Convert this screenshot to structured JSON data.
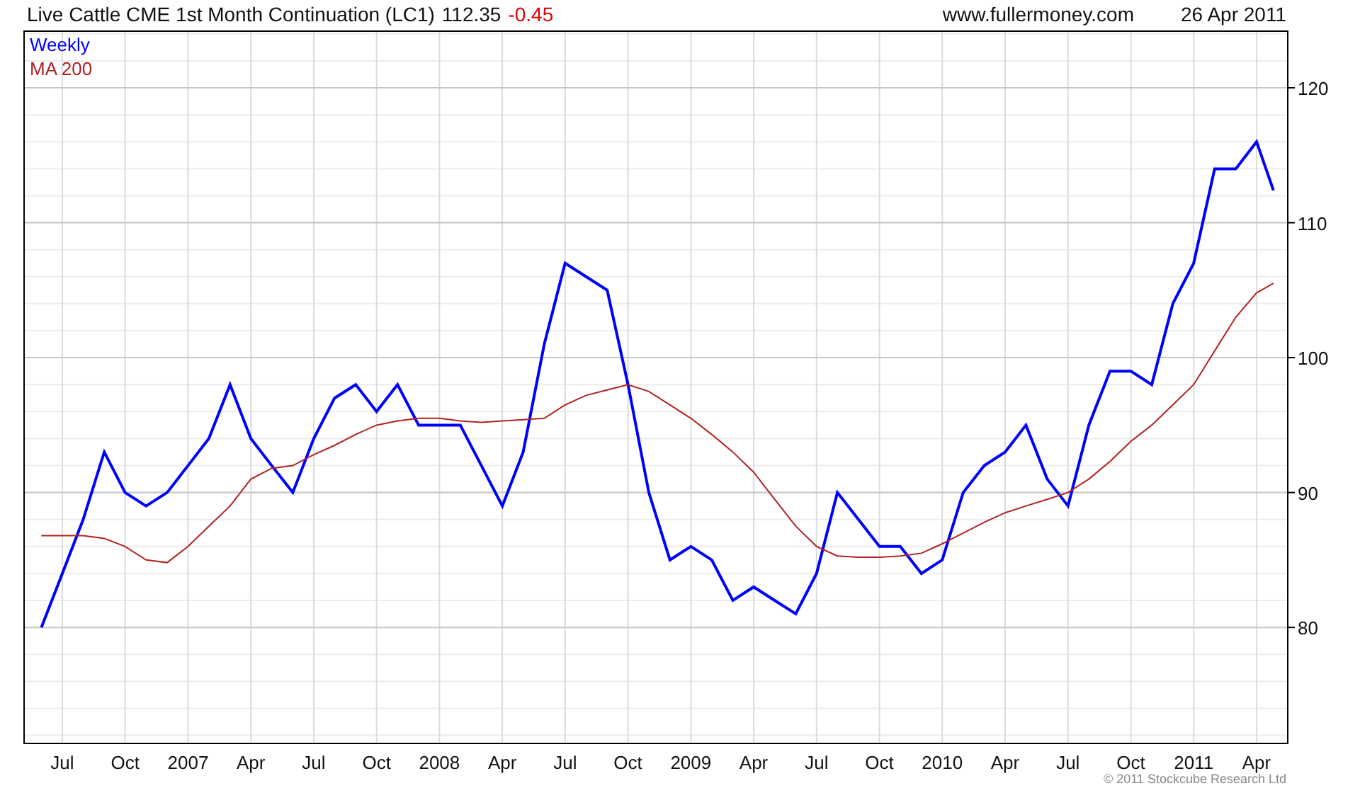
{
  "header": {
    "title": "Live Cattle CME 1st Month Continuation (LC1)",
    "price": "112.35",
    "change": "-0.45",
    "site": "www.fullermoney.com",
    "date": "26 Apr 2011"
  },
  "chart": {
    "chart_data": {
      "type": "line",
      "grid": true,
      "xlim": [
        2006.348,
        2011.374
      ],
      "ylim": [
        71.4,
        124.2
      ],
      "xticks": [
        {
          "value": 2006.5,
          "label": "Jul"
        },
        {
          "value": 2006.75,
          "label": "Oct"
        },
        2007,
        {
          "value": 2007.25,
          "label": "Apr"
        },
        {
          "value": 2007.5,
          "label": "Jul"
        },
        {
          "value": 2007.75,
          "label": "Oct"
        },
        2008,
        {
          "value": 2008.25,
          "label": "Apr"
        },
        {
          "value": 2008.5,
          "label": "Jul"
        },
        {
          "value": 2008.75,
          "label": "Oct"
        },
        2009,
        {
          "value": 2009.25,
          "label": "Apr"
        },
        {
          "value": 2009.5,
          "label": "Jul"
        },
        {
          "value": 2009.75,
          "label": "Oct"
        },
        2010,
        {
          "value": 2010.25,
          "label": "Apr"
        },
        {
          "value": 2010.5,
          "label": "Jul"
        },
        {
          "value": 2010.75,
          "label": "Oct"
        },
        2011,
        {
          "value": 2011.25,
          "label": "Apr"
        }
      ],
      "yticks": [
        80,
        90,
        100,
        110,
        120
      ],
      "x": [
        2006.417,
        2006.5,
        2006.583,
        2006.667,
        2006.75,
        2006.833,
        2006.917,
        2007,
        2007.083,
        2007.167,
        2007.25,
        2007.333,
        2007.417,
        2007.5,
        2007.583,
        2007.667,
        2007.75,
        2007.833,
        2007.917,
        2008,
        2008.083,
        2008.167,
        2008.25,
        2008.333,
        2008.417,
        2008.5,
        2008.583,
        2008.667,
        2008.75,
        2008.833,
        2008.917,
        2009,
        2009.083,
        2009.167,
        2009.25,
        2009.333,
        2009.417,
        2009.5,
        2009.583,
        2009.667,
        2009.75,
        2009.833,
        2009.917,
        2010,
        2010.083,
        2010.167,
        2010.25,
        2010.333,
        2010.417,
        2010.5,
        2010.583,
        2010.667,
        2010.75,
        2010.833,
        2010.917,
        2011,
        2011.083,
        2011.167,
        2011.25,
        2011.317
      ],
      "series": [
        {
          "name": "Weekly",
          "color": "#0000ff",
          "values": [
            80,
            84,
            88,
            93,
            90,
            89,
            90,
            92,
            94,
            98,
            94,
            92,
            90,
            94,
            97,
            98,
            96,
            98,
            95,
            95,
            95,
            92,
            89,
            93,
            101,
            107,
            106,
            105,
            98,
            90,
            85,
            86,
            85,
            82,
            83,
            82,
            81,
            84,
            90,
            88,
            86,
            86,
            84,
            85,
            90,
            92,
            93,
            95,
            91,
            89,
            95,
            99,
            99,
            98,
            104,
            107,
            114,
            114,
            116,
            112.4
          ]
        },
        {
          "name": "MA 200",
          "color": "#b22222",
          "values": [
            86.8,
            86.8,
            86.8,
            86.6,
            86,
            85,
            84.8,
            86,
            87.5,
            89,
            91,
            91.8,
            92,
            92.8,
            93.5,
            94.3,
            95,
            95.3,
            95.5,
            95.5,
            95.3,
            95.2,
            95.3,
            95.4,
            95.5,
            96.5,
            97.2,
            97.6,
            98,
            97.5,
            96.5,
            95.5,
            94.3,
            93,
            91.5,
            89.5,
            87.5,
            86,
            85.3,
            85.2,
            85.2,
            85.3,
            85.5,
            86.2,
            87,
            87.8,
            88.5,
            89,
            89.5,
            90,
            91,
            92.3,
            93.8,
            95,
            96.5,
            98,
            100.5,
            103,
            104.8,
            105.5
          ]
        }
      ]
    }
  },
  "copyright": "© 2011 Stockcube Research Ltd"
}
